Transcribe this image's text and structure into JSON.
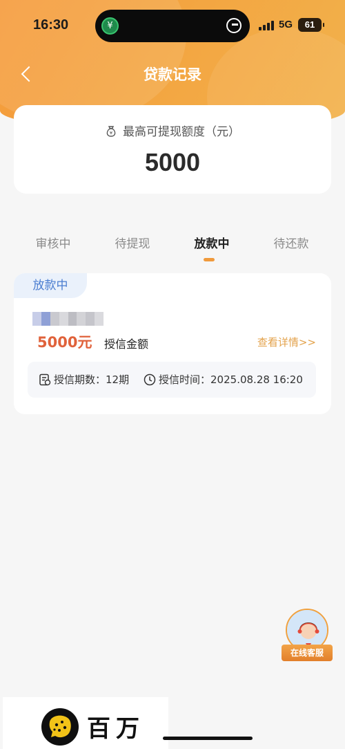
{
  "status_bar": {
    "time": "16:30",
    "network": "5G",
    "battery": "61"
  },
  "header": {
    "title": "贷款记录",
    "back_icon": "chevron-left-icon"
  },
  "limit_card": {
    "label": "最高可提现额度（元）",
    "amount": "5000",
    "icon": "money-bag-icon"
  },
  "tabs": [
    {
      "label": "审核中",
      "active": false
    },
    {
      "label": "待提现",
      "active": false
    },
    {
      "label": "放款中",
      "active": true
    },
    {
      "label": "待还款",
      "active": false
    }
  ],
  "record": {
    "status": "放款中",
    "amount": "5000元",
    "amount_label": "授信金额",
    "detail_link": "查看详情>>",
    "term_label": "授信期数：",
    "term_value": "12期",
    "time_label": "授信时间：",
    "time_value": "2025.08.28 16:20"
  },
  "customer_service": {
    "label": "在线客服"
  },
  "brand": {
    "name": "百万豹"
  },
  "colors": {
    "header_gradient_start": "#f59a3a",
    "header_gradient_end": "#f2b24c",
    "amount_red": "#e0623b",
    "link_orange": "#e3a24b",
    "status_blue": "#4a7dd0",
    "tab_indicator": "#f09a3c"
  }
}
